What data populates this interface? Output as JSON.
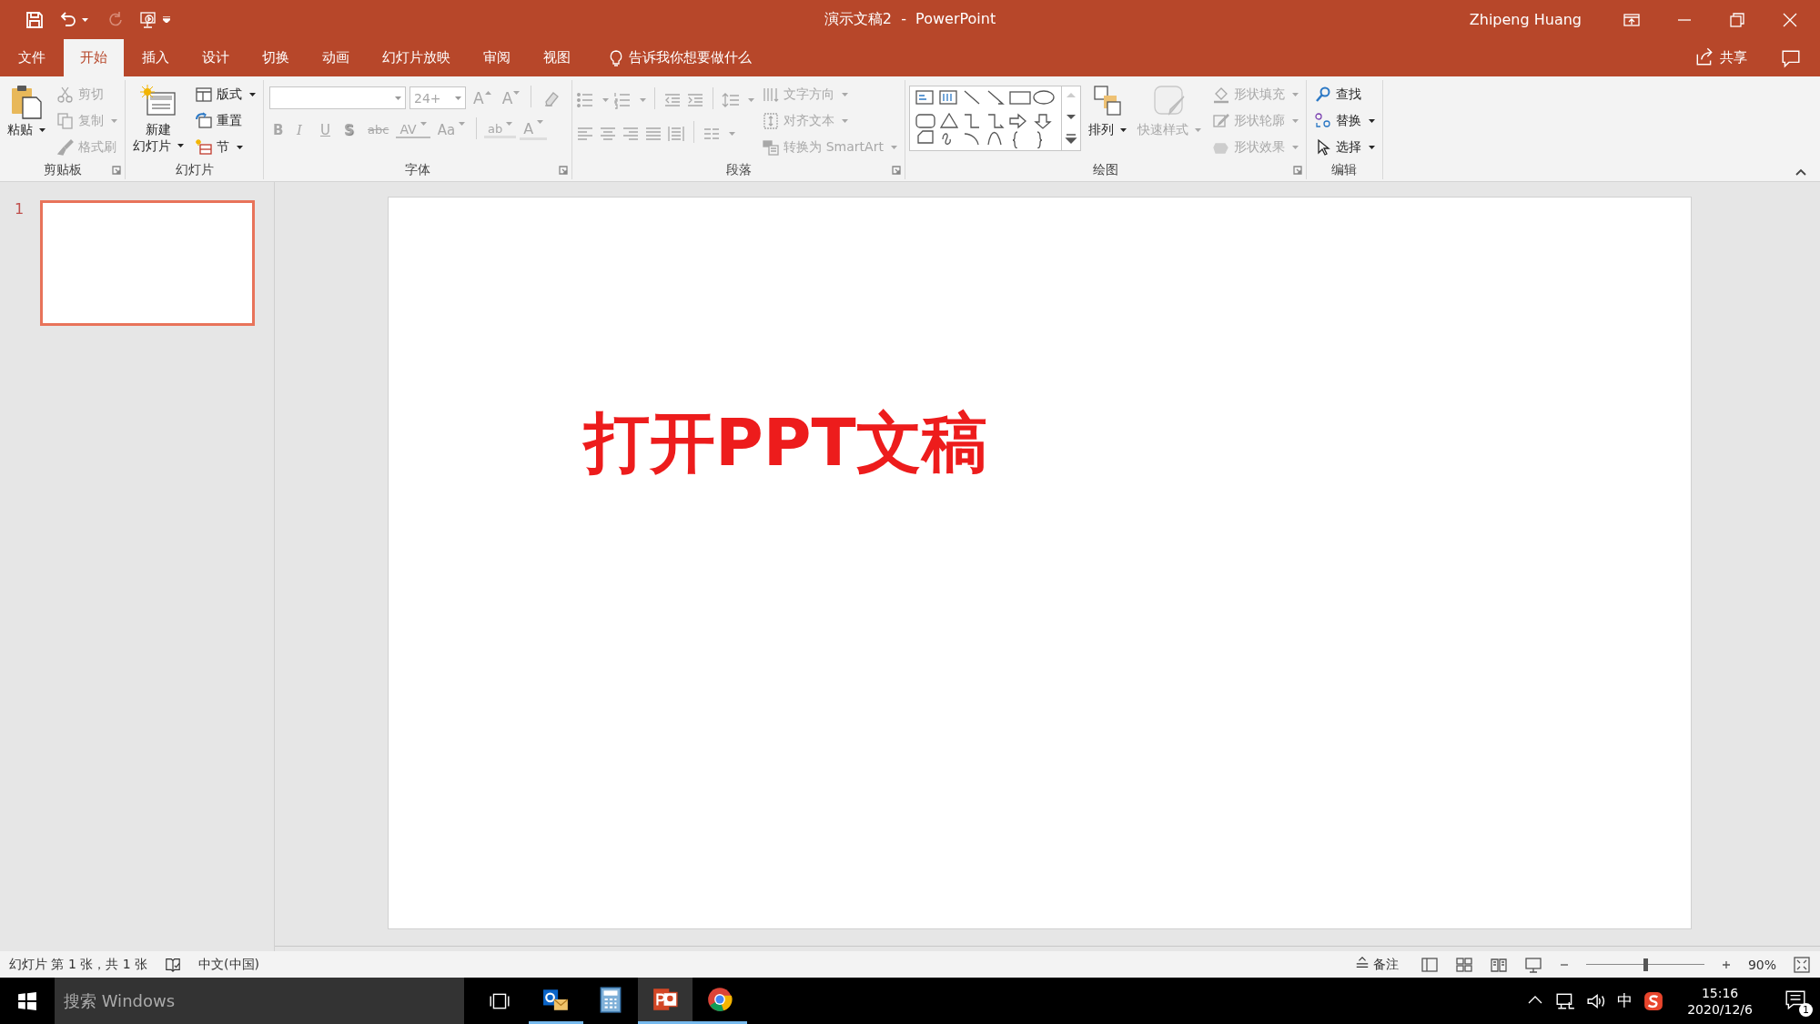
{
  "window": {
    "title": "演示文稿2  -  PowerPoint",
    "user": "Zhipeng Huang"
  },
  "tabs": [
    {
      "label": "文件",
      "selected": false
    },
    {
      "label": "开始",
      "selected": true
    },
    {
      "label": "插入",
      "selected": false
    },
    {
      "label": "设计",
      "selected": false
    },
    {
      "label": "切换",
      "selected": false
    },
    {
      "label": "动画",
      "selected": false
    },
    {
      "label": "幻灯片放映",
      "selected": false
    },
    {
      "label": "审阅",
      "selected": false
    },
    {
      "label": "视图",
      "selected": false
    }
  ],
  "tell_me": "告诉我你想要做什么",
  "share": "共享",
  "ribbon": {
    "groups": [
      {
        "label": "剪贴板",
        "launcher": true,
        "items": [
          {
            "kind": "large",
            "lines": [
              "粘贴"
            ],
            "disabled": false,
            "dropdown": true
          },
          {
            "kind": "column",
            "items": [
              {
                "label": "剪切",
                "disabled": true,
                "dropdown": false
              },
              {
                "label": "复制",
                "disabled": true,
                "dropdown": true
              },
              {
                "label": "格式刷",
                "disabled": true,
                "dropdown": false
              }
            ]
          }
        ]
      },
      {
        "label": "幻灯片",
        "launcher": false,
        "items": [
          {
            "kind": "large",
            "lines": [
              "新建",
              "幻灯片"
            ],
            "disabled": false,
            "dropdown": true
          },
          {
            "kind": "column",
            "items": [
              {
                "label": "版式",
                "disabled": false,
                "dropdown": true
              },
              {
                "label": "重置",
                "disabled": false,
                "dropdown": false
              },
              {
                "label": "节",
                "disabled": false,
                "dropdown": true
              }
            ]
          }
        ]
      },
      {
        "label": "字体",
        "launcher": true,
        "items": [
          {
            "kind": "font",
            "size": "24+",
            "row1": [
              {
                "label": "A",
                "kind": "grow",
                "disabled": true
              },
              {
                "label": "A",
                "kind": "shrink",
                "disabled": true
              }
            ],
            "row2": [
              {
                "label": "B",
                "kind": "bold",
                "disabled": true
              },
              {
                "label": "I",
                "kind": "italic",
                "disabled": true
              },
              {
                "label": "U",
                "kind": "underline",
                "disabled": true
              },
              {
                "label": "S",
                "kind": "shadow",
                "disabled": true
              },
              {
                "label": "abc",
                "kind": "strike",
                "disabled": true
              },
              {
                "label": "AV",
                "kind": "spacing",
                "disabled": true
              },
              {
                "label": "Aa",
                "kind": "case",
                "disabled": true
              },
              {
                "label": "ab",
                "kind": "highlight",
                "disabled": true
              },
              {
                "label": "A",
                "kind": "color",
                "disabled": true
              }
            ]
          }
        ]
      },
      {
        "label": "段落",
        "launcher": true,
        "items": [
          {
            "kind": "paragraph_icons"
          },
          {
            "kind": "column",
            "items": [
              {
                "label": "文字方向",
                "disabled": true,
                "dropdown": true
              },
              {
                "label": "对齐文本",
                "disabled": true,
                "dropdown": true
              },
              {
                "label": "转换为 SmartArt",
                "disabled": true,
                "dropdown": true
              }
            ]
          }
        ]
      },
      {
        "label": "绘图",
        "launcher": true,
        "items": [
          {
            "kind": "shapes"
          },
          {
            "kind": "large",
            "lines": [
              "排列"
            ],
            "disabled": false,
            "dropdown": true
          },
          {
            "kind": "large",
            "lines": [
              "快速样式"
            ],
            "disabled": true,
            "dropdown": true
          },
          {
            "kind": "column",
            "items": [
              {
                "label": "形状填充",
                "disabled": true,
                "dropdown": true
              },
              {
                "label": "形状轮廓",
                "disabled": true,
                "dropdown": true
              },
              {
                "label": "形状效果",
                "disabled": true,
                "dropdown": true
              }
            ]
          }
        ]
      },
      {
        "label": "编辑",
        "launcher": false,
        "items": [
          {
            "kind": "column",
            "items": [
              {
                "label": "查找",
                "disabled": false,
                "dropdown": false
              },
              {
                "label": "替换",
                "disabled": false,
                "dropdown": true
              },
              {
                "label": "选择",
                "disabled": false,
                "dropdown": true
              }
            ]
          }
        ]
      }
    ]
  },
  "slide_panel": {
    "thumbnails": [
      {
        "number": "1",
        "selected": true
      }
    ]
  },
  "slide": {
    "title": "打开PPT文稿"
  },
  "status_bar": {
    "slide_info": "幻灯片 第 1 张，共 1 张",
    "language": "中文(中国)",
    "notes": "备注",
    "zoom": {
      "level": 0.5,
      "reading": "90%"
    }
  },
  "taskbar": {
    "search": {
      "placeholder": "搜索 Windows"
    },
    "apps": [
      {
        "running": true,
        "active": false
      },
      {
        "running": false,
        "active": false
      },
      {
        "running": true,
        "active": true
      },
      {
        "running": true,
        "active": false
      }
    ],
    "ime": "中",
    "time": "15:16",
    "date": "2020/12/6",
    "notifications": "1"
  }
}
